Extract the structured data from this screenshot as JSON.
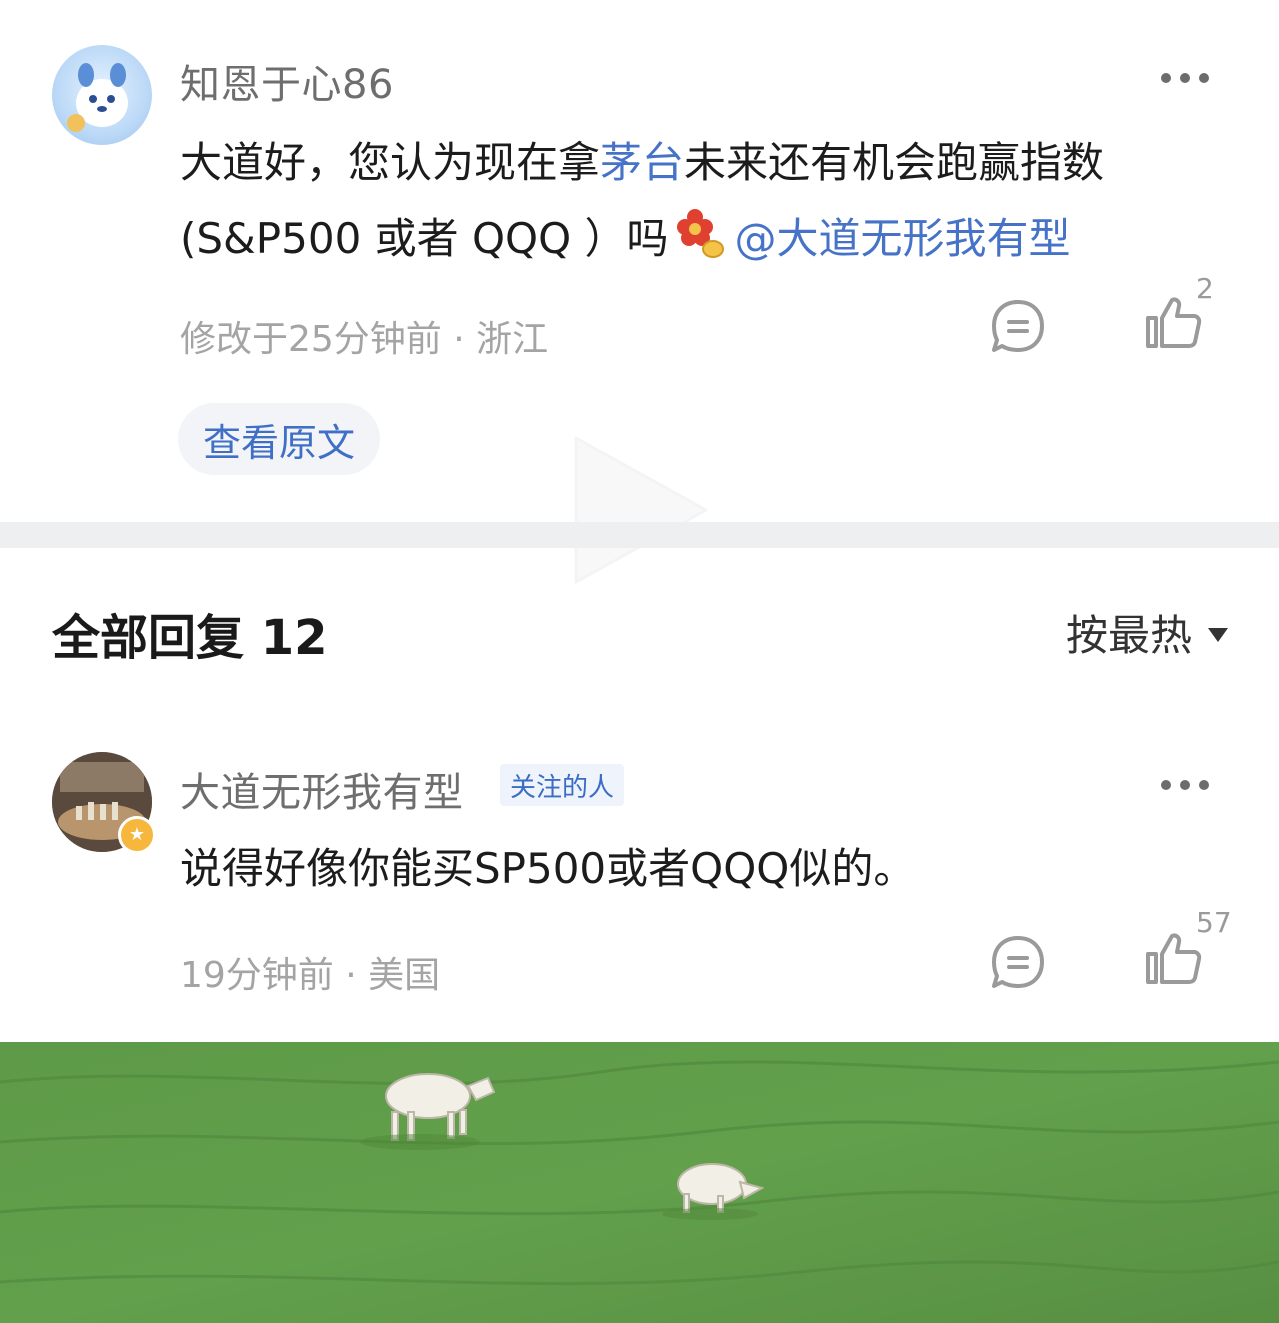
{
  "comment": {
    "username": "知恩于心86",
    "text_line1_before": "大道好，您认为现在拿",
    "text_line1_link": "茅台",
    "text_line1_after": "未来还有机会跑赢指数",
    "text_line2_before": "(S&P500 或者 QQQ ）吗",
    "mention": "@大道无形我有型",
    "meta": "修改于25分钟前 · 浙江",
    "like_count": "2",
    "view_original_label": "查看原文"
  },
  "replies": {
    "header": "全部回复 12",
    "sort_label": "按最热"
  },
  "reply": {
    "username": "大道无形我有型",
    "tag": "关注的人",
    "text": "说得好像你能买SP500或者QQQ似的。",
    "meta": "19分钟前 · 美国",
    "like_count": "57"
  },
  "colors": {
    "link": "#4673c8",
    "meta_text": "#a4a4a4",
    "divider": "#eeeff1",
    "grass": "#5f9a48"
  },
  "icons": [
    "more-icon",
    "reply-icon",
    "like-icon",
    "chevron-down-icon",
    "play-icon",
    "flower-emoji-icon",
    "vip-star-icon"
  ]
}
